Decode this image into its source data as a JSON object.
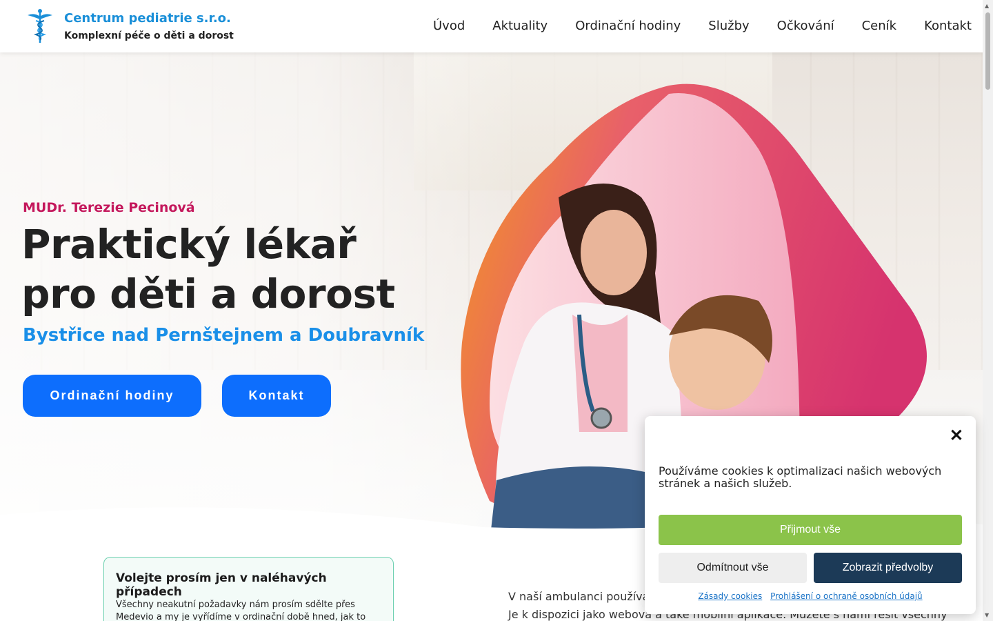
{
  "header": {
    "brand_name": "Centrum pediatrie s.r.o.",
    "brand_tagline": "Komplexní péče o děti a dorost",
    "nav": [
      "Úvod",
      "Aktuality",
      "Ordinační hodiny",
      "Služby",
      "Očkování",
      "Ceník",
      "Kontakt"
    ]
  },
  "hero": {
    "doctor_name": "MUDr. Terezie Pecinová",
    "title_line1": "Praktický lékař",
    "title_line2": "pro děti a dorost",
    "location": "Bystřice nad Pernštejnem a Doubravník",
    "btn_hours": "Ordinační hodiny",
    "btn_contact": "Kontakt"
  },
  "notice": {
    "title": "Volejte prosím jen v naléhavých případech",
    "text": "Všechny neakutní požadavky nám prosím sdělte přes Medevio a my je vyřídíme v ordinační době hned, jak to bude"
  },
  "intro": {
    "line1": "V naší ambulanci používám",
    "line2": "Je k dispozici jako webová a také mobilní aplikace. Můžete s námi řešit všechny neakutní"
  },
  "cookie": {
    "text": "Používáme cookies k optimalizaci našich webových stránek a našich služeb.",
    "accept": "Přijmout vše",
    "deny": "Odmítnout vše",
    "prefs": "Zobrazit předvolby",
    "link_cookies": "Zásady cookies",
    "link_privacy": "Prohlášení o ochraně osobních údajů",
    "close_glyph": "✕"
  },
  "colors": {
    "brand_blue": "#1a8fd8",
    "button_blue": "#0d6efd",
    "accent_pink": "#c4185c",
    "accept_green": "#8bc34a",
    "prefs_navy": "#1c3a57"
  }
}
